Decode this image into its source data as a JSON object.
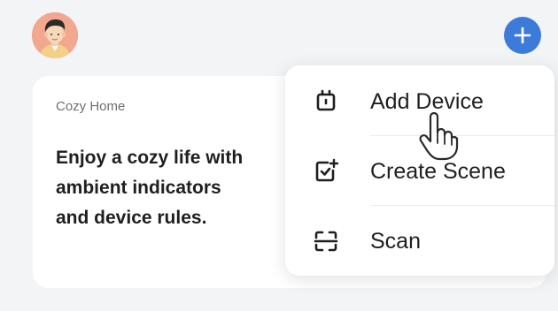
{
  "header": {
    "avatar_icon": "user-avatar-icon",
    "add_icon": "plus-icon"
  },
  "card": {
    "title": "Cozy Home",
    "description_lines": [
      "Enjoy a cozy life with",
      "ambient indicators",
      "and device rules."
    ]
  },
  "menu": {
    "items": [
      {
        "label": "Add Device",
        "icon": "device-icon"
      },
      {
        "label": "Create Scene",
        "icon": "scene-check-plus-icon"
      },
      {
        "label": "Scan",
        "icon": "scan-frame-icon"
      }
    ]
  },
  "cursor": {
    "icon": "hand-pointer-icon"
  },
  "colors": {
    "accent": "#3d7bdb",
    "background": "#f3f4f6",
    "surface": "#ffffff",
    "text_primary": "#1f1f1f",
    "text_secondary": "#6f6f6f",
    "avatar_bg": "#f2a88f"
  }
}
